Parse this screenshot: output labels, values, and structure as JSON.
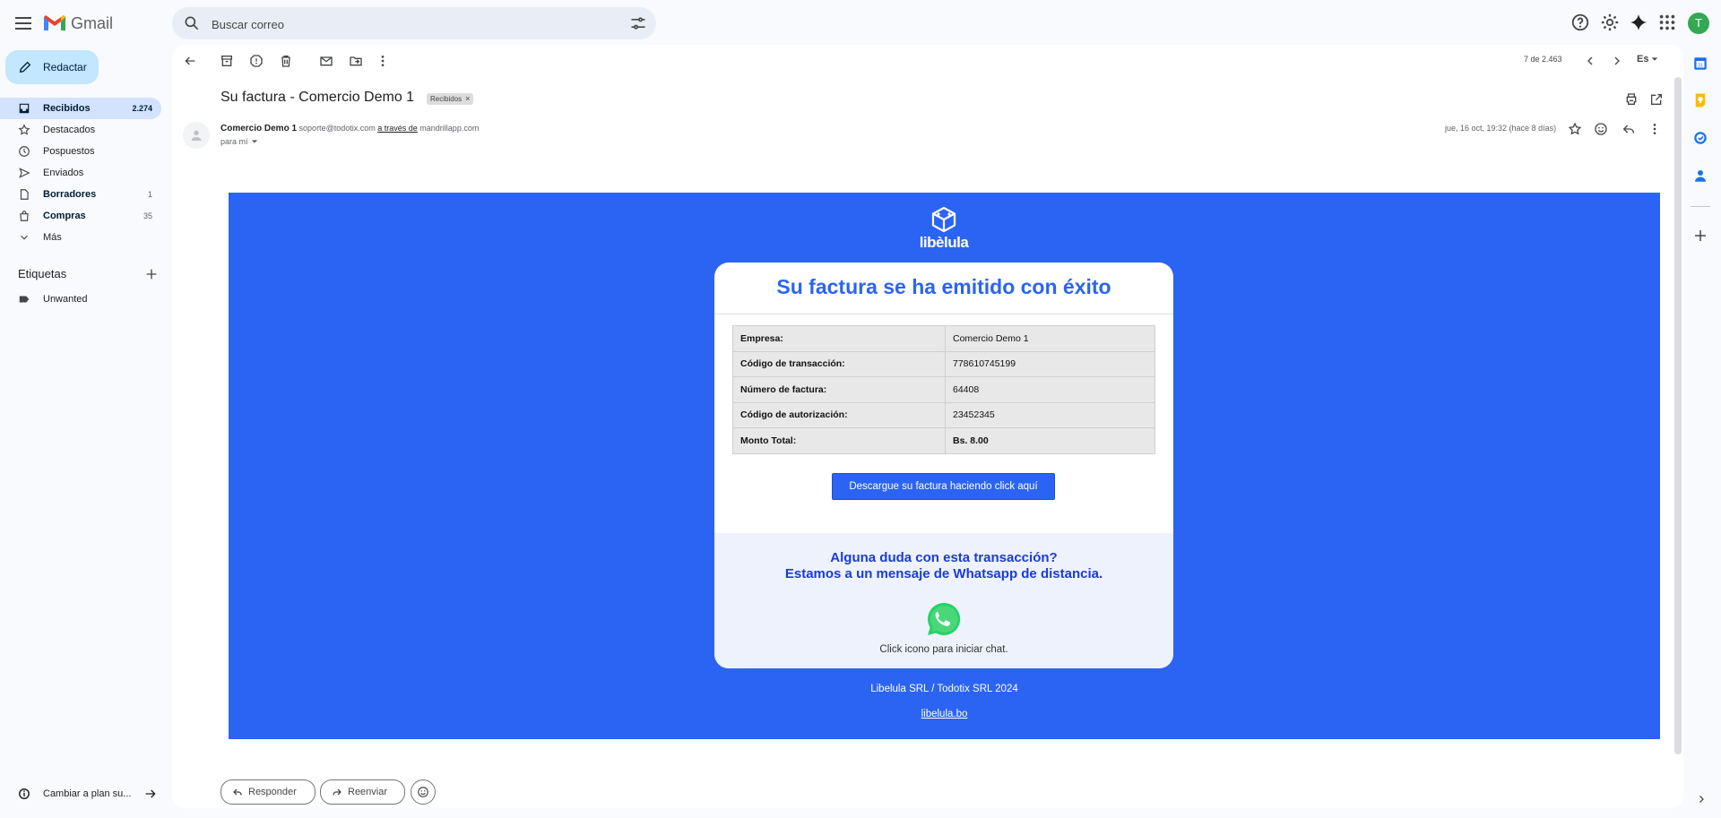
{
  "app": {
    "name": "Gmail"
  },
  "search": {
    "placeholder": "Buscar correo"
  },
  "account": {
    "initial": "T"
  },
  "nav": {
    "compose_label": "Redactar",
    "items": [
      {
        "label": "Recibidos",
        "count": "2.274",
        "icon": "inbox-icon"
      },
      {
        "label": "Destacados",
        "count": "",
        "icon": "star-icon"
      },
      {
        "label": "Pospuestos",
        "count": "",
        "icon": "clock-icon"
      },
      {
        "label": "Enviados",
        "count": "",
        "icon": "send-icon"
      },
      {
        "label": "Borradores",
        "count": "1",
        "icon": "draft-icon"
      },
      {
        "label": "Compras",
        "count": "35",
        "icon": "shopping-bag-icon"
      },
      {
        "label": "Más",
        "count": "",
        "icon": "chevron-down-icon"
      }
    ],
    "labels_heading": "Etiquetas",
    "labels": [
      {
        "label": "Unwanted"
      }
    ],
    "footer_text": "Cambiar a plan su..."
  },
  "toolbar": {
    "pager": "7 de 2.463",
    "lang": "Es"
  },
  "message": {
    "subject": "Su factura - Comercio Demo 1",
    "label_chip": "Recibidos",
    "sender_name": "Comercio Demo 1",
    "sender_email": "soporte@todotix.com",
    "via_text": "a través de",
    "via_domain": "mandrillapp.com",
    "to_text": "para mí",
    "date": "jue, 16 oct, 19:32 (hace 8 días)"
  },
  "email": {
    "brand_name": "libèlula",
    "title": "Su factura se ha emitido con éxito",
    "rows": [
      {
        "key": "Empresa:",
        "value": "Comercio Demo 1"
      },
      {
        "key": "Código de transacción:",
        "value": "778610745199"
      },
      {
        "key": "Número de factura:",
        "value": "64408"
      },
      {
        "key": "Código de autorización:",
        "value": "23452345"
      },
      {
        "key": "Monto Total:",
        "value": "Bs. 8.00"
      }
    ],
    "download_button": "Descargue su factura haciendo click aquí",
    "help_line1": "Alguna duda con esta transacción?",
    "help_line2": "Estamos a un mensaje de Whatsapp de distancia.",
    "whatsapp_caption": "Click icono para iniciar chat.",
    "copyright": "Libelula SRL / Todotix SRL 2024",
    "site_link": "libelula.bo",
    "colors": {
      "brand_blue": "#2b64f3",
      "whatsapp_green": "#25d366"
    }
  },
  "actions": {
    "reply": "Responder",
    "forward": "Reenviar"
  }
}
